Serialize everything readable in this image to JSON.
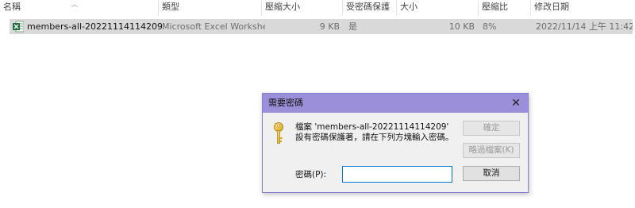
{
  "columns": {
    "name": "名稱",
    "type": "類型",
    "compressed_size": "壓縮大小",
    "password_protected": "受密碼保護",
    "size": "大小",
    "ratio": "壓縮比",
    "modified": "修改日期"
  },
  "file": {
    "icon": "excel-file-icon",
    "name": "members-all-20221114114209",
    "type": "Microsoft Excel Worksheet",
    "compressed_size": "9 KB",
    "password_protected": "是",
    "size": "10 KB",
    "ratio": "8%",
    "modified": "2022/11/14 上午 11:42"
  },
  "dialog": {
    "title": "需要密碼",
    "close": "✕",
    "message": "檔案 'members-all-20221114114209' 設有密碼保護著，請在下列方塊輸入密碼。",
    "password_label": "密碼(P):",
    "password_value": "",
    "ok": "確定",
    "skip_file": "略過檔案(K)",
    "cancel": "取消"
  },
  "colors": {
    "titlebar": "#9a8fd8",
    "selection": "#d9d9d9",
    "excel_green": "#1d6f42",
    "input_border": "#0078d7"
  }
}
